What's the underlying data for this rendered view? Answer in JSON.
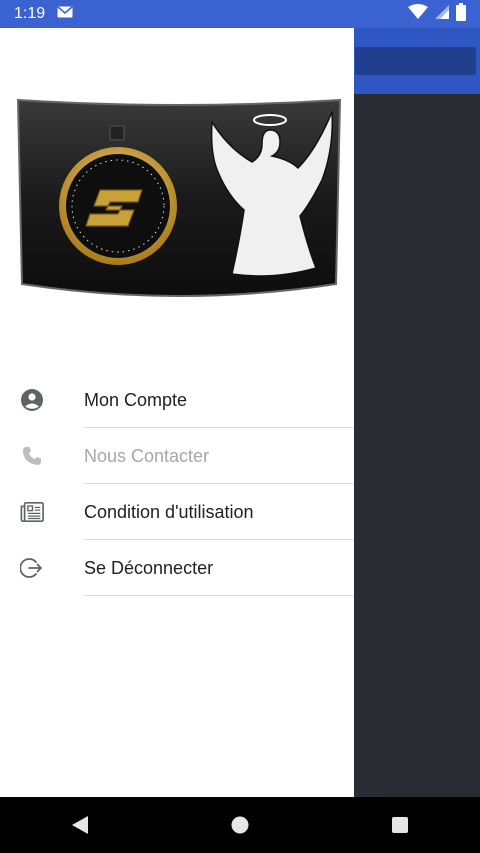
{
  "status_bar": {
    "time": "1:19",
    "icons": [
      "gmail-icon",
      "wifi-icon",
      "signal-icon",
      "battery-icon"
    ]
  },
  "drawer": {
    "logo": {
      "letter": "S"
    },
    "menu": [
      {
        "label": "Mon Compte",
        "icon": "account-circle-icon",
        "enabled": true
      },
      {
        "label": "Nous Contacter",
        "icon": "phone-icon",
        "enabled": false
      },
      {
        "label": "Condition d'utilisation",
        "icon": "newspaper-icon",
        "enabled": true
      },
      {
        "label": "Se Déconnecter",
        "icon": "logout-icon",
        "enabled": true
      }
    ]
  },
  "nav_bar": {
    "buttons": [
      "back-icon",
      "home-icon",
      "recents-icon"
    ]
  },
  "colors": {
    "status_bar": "#3a62d0",
    "app_bar": "#2f57c4",
    "scrim": "#2a2c33",
    "menu_text": "#202124",
    "menu_text_disabled": "#a7a7a7",
    "icon": "#5f6368"
  }
}
